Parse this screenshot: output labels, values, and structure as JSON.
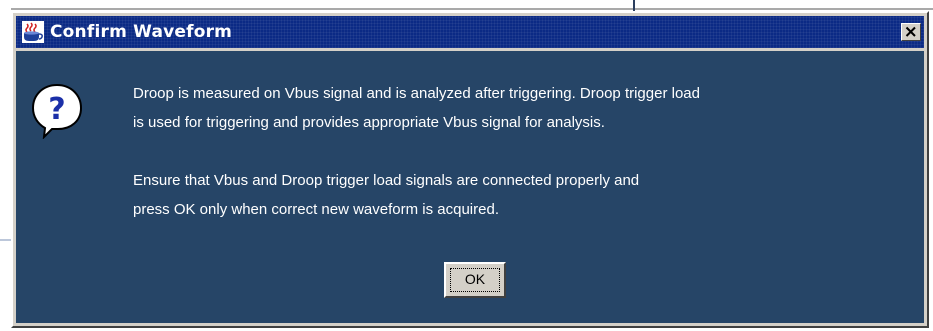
{
  "window": {
    "title": "Confirm Waveform",
    "title_icon": "java-coffee-cup-icon",
    "close_icon": "close-icon"
  },
  "message": {
    "icon": "question-icon",
    "paragraph1_line1": "Droop is measured on Vbus signal and is analyzed after triggering. Droop trigger load",
    "paragraph1_line2": "is used for triggering and provides appropriate Vbus signal for analysis.",
    "paragraph2_line1": "Ensure that Vbus and Droop trigger load signals are connected properly and",
    "paragraph2_line2": "press OK only when correct new waveform is acquired."
  },
  "buttons": {
    "ok_label": "OK"
  },
  "colors": {
    "titlebar": "#0b2a85",
    "content_background": "#264567",
    "dialog_frame": "#d4d0c8",
    "text": "#ffffff"
  }
}
